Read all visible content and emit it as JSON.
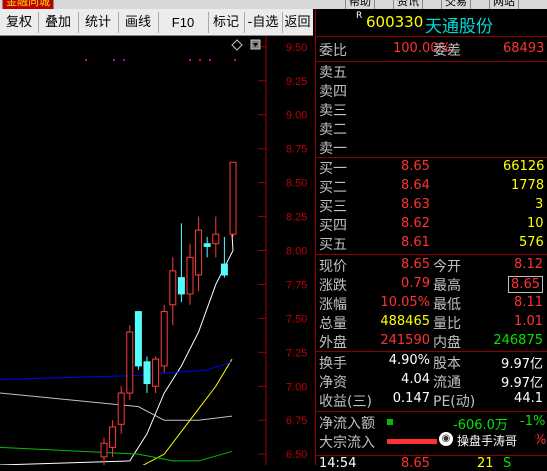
{
  "top_tabs": [
    "金融同城",
    "帮助",
    "资讯",
    "交易",
    "网站"
  ],
  "toolbar": {
    "buttons": [
      "复权",
      "叠加",
      "统计",
      "画线",
      "F10",
      "标记",
      "-自选",
      "返回"
    ]
  },
  "chart": {
    "price_ticks": [
      "9.50",
      "9.25",
      "9.00",
      "8.75",
      "8.50",
      "8.25",
      "8.00",
      "7.75",
      "7.50",
      "7.25",
      "7.00",
      "6.75",
      "6.50"
    ]
  },
  "chart_data": {
    "type": "candlestick",
    "ylim": [
      6.42,
      9.58
    ],
    "candles": [
      {
        "o": 6.48,
        "h": 6.62,
        "l": 6.42,
        "c": 6.58
      },
      {
        "o": 6.55,
        "h": 6.75,
        "l": 6.48,
        "c": 6.7
      },
      {
        "o": 6.72,
        "h": 7.0,
        "l": 6.65,
        "c": 6.95
      },
      {
        "o": 6.95,
        "h": 7.45,
        "l": 6.9,
        "c": 7.4
      },
      {
        "o": 7.55,
        "h": 7.55,
        "l": 7.12,
        "c": 7.15
      },
      {
        "o": 7.18,
        "h": 7.22,
        "l": 6.95,
        "c": 7.02
      },
      {
        "o": 7.0,
        "h": 7.22,
        "l": 6.95,
        "c": 7.2
      },
      {
        "o": 7.15,
        "h": 7.6,
        "l": 7.1,
        "c": 7.55
      },
      {
        "o": 7.6,
        "h": 7.95,
        "l": 7.45,
        "c": 7.85
      },
      {
        "o": 7.8,
        "h": 8.2,
        "l": 7.62,
        "c": 7.68
      },
      {
        "o": 7.68,
        "h": 8.05,
        "l": 7.6,
        "c": 7.95
      },
      {
        "o": 7.82,
        "h": 8.25,
        "l": 7.7,
        "c": 8.15
      },
      {
        "o": 8.05,
        "h": 8.1,
        "l": 7.95,
        "c": 8.03
      },
      {
        "o": 8.05,
        "h": 8.25,
        "l": 7.95,
        "c": 8.12
      },
      {
        "o": 7.9,
        "h": 8.1,
        "l": 7.8,
        "c": 7.82
      },
      {
        "o": 8.12,
        "h": 8.65,
        "l": 8.1,
        "c": 8.65
      }
    ],
    "ma_series": [
      {
        "color": "#ffffff",
        "points": [
          [
            6.42,
            0
          ],
          [
            6.45,
            3
          ],
          [
            6.65,
            5
          ],
          [
            6.95,
            7
          ],
          [
            7.15,
            9
          ],
          [
            7.4,
            11
          ],
          [
            7.75,
            13
          ],
          [
            8.0,
            15
          ],
          [
            8.12,
            16
          ]
        ]
      },
      {
        "color": "#ffff00",
        "points": [
          [
            6.4,
            4
          ],
          [
            6.5,
            7
          ],
          [
            6.75,
            10
          ],
          [
            7.0,
            13
          ],
          [
            7.2,
            16
          ]
        ]
      },
      {
        "color": "#0000ff",
        "points": [
          [
            7.05,
            0
          ],
          [
            7.08,
            4
          ],
          [
            7.1,
            8
          ],
          [
            7.12,
            12
          ],
          [
            7.18,
            16
          ]
        ]
      },
      {
        "color": "#c0c0c0",
        "points": [
          [
            6.95,
            0
          ],
          [
            6.85,
            4
          ],
          [
            6.75,
            7
          ],
          [
            6.75,
            11
          ],
          [
            6.78,
            16
          ]
        ]
      },
      {
        "color": "#00c000",
        "points": [
          [
            6.55,
            0
          ],
          [
            6.5,
            4
          ],
          [
            6.45,
            8
          ],
          [
            6.45,
            11
          ],
          [
            6.52,
            16
          ]
        ]
      }
    ]
  },
  "quote": {
    "code": "600330",
    "name": "天通股份",
    "wb_label": "委比",
    "wb_value": "100.00%",
    "wc_label": "委差",
    "wc_value": "68493",
    "sells": [
      {
        "label": "卖五",
        "price": "",
        "vol": ""
      },
      {
        "label": "卖四",
        "price": "",
        "vol": ""
      },
      {
        "label": "卖三",
        "price": "",
        "vol": ""
      },
      {
        "label": "卖二",
        "price": "",
        "vol": ""
      },
      {
        "label": "卖一",
        "price": "",
        "vol": ""
      }
    ],
    "buys": [
      {
        "label": "买一",
        "price": "8.65",
        "vol": "66126"
      },
      {
        "label": "买二",
        "price": "8.64",
        "vol": "1778"
      },
      {
        "label": "买三",
        "price": "8.63",
        "vol": "3"
      },
      {
        "label": "买四",
        "price": "8.62",
        "vol": "10"
      },
      {
        "label": "买五",
        "price": "8.61",
        "vol": "576"
      }
    ],
    "stats": [
      {
        "l1": "现价",
        "v1": "8.65",
        "c1": "red",
        "l2": "今开",
        "v2": "8.12",
        "c2": "red"
      },
      {
        "l1": "涨跌",
        "v1": "0.79",
        "c1": "red",
        "l2": "最高",
        "v2": "8.65",
        "c2": "red"
      },
      {
        "l1": "涨幅",
        "v1": "10.05%",
        "c1": "red",
        "l2": "最低",
        "v2": "8.11",
        "c2": "red"
      },
      {
        "l1": "总量",
        "v1": "488465",
        "c1": "yel",
        "l2": "量比",
        "v2": "1.01",
        "c2": "red"
      },
      {
        "l1": "外盘",
        "v1": "241590",
        "c1": "red",
        "l2": "内盘",
        "v2": "246875",
        "c2": "green"
      }
    ],
    "stats2": [
      {
        "l1": "换手",
        "v1": "4.90%",
        "l2": "股本",
        "v2": "9.97亿"
      },
      {
        "l1": "净资",
        "v1": "4.04",
        "l2": "流通",
        "v2": "9.97亿"
      },
      {
        "l1": "收益(三)",
        "v1": "0.147",
        "l2": "PE(动)",
        "v2": "44.1"
      }
    ],
    "flow": [
      {
        "label": "净流入额",
        "value": "-606.0万",
        "pct": "-1%"
      },
      {
        "label": "大宗流入",
        "value": "",
        "pct": "%"
      }
    ],
    "watermark": "操盘手涛哥",
    "last_time": "14:54",
    "last_price": "8.65",
    "last_vol": "21",
    "last_flag": "S"
  }
}
